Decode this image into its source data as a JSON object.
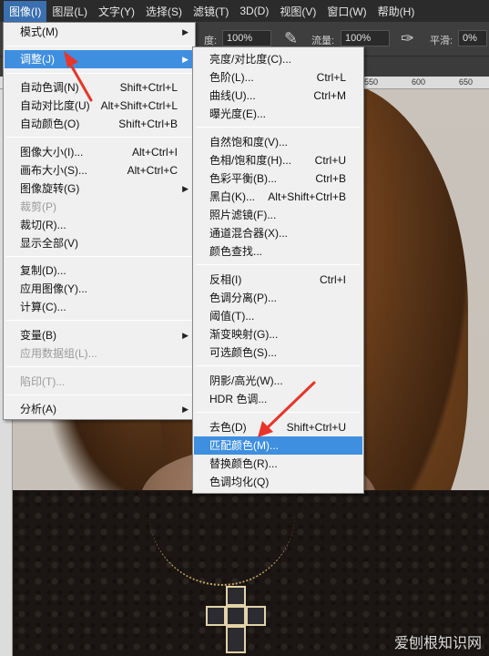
{
  "menubar": {
    "items": [
      {
        "label": "图像(I)",
        "active": true
      },
      {
        "label": "图层(L)"
      },
      {
        "label": "文字(Y)"
      },
      {
        "label": "选择(S)"
      },
      {
        "label": "滤镜(T)"
      },
      {
        "label": "3D(D)"
      },
      {
        "label": "视图(V)"
      },
      {
        "label": "窗口(W)"
      },
      {
        "label": "帮助(H)"
      }
    ]
  },
  "options_bar": {
    "opacity_label": "度:",
    "opacity_value": "100%",
    "flow_label": "流量:",
    "flow_value": "100%",
    "smoothing_label": "平滑:",
    "smoothing_value": "0%"
  },
  "ruler": {
    "top_ticks": [
      "550",
      "600",
      "650"
    ]
  },
  "image_menu": {
    "items": [
      {
        "label": "模式(M)",
        "submenu": true
      },
      {
        "label": "调整(J)",
        "submenu": true,
        "highlighted": true
      },
      {
        "label": "自动色调(N)",
        "shortcut": "Shift+Ctrl+L"
      },
      {
        "label": "自动对比度(U)",
        "shortcut": "Alt+Shift+Ctrl+L"
      },
      {
        "label": "自动颜色(O)",
        "shortcut": "Shift+Ctrl+B"
      },
      {
        "label": "图像大小(I)...",
        "shortcut": "Alt+Ctrl+I"
      },
      {
        "label": "画布大小(S)...",
        "shortcut": "Alt+Ctrl+C"
      },
      {
        "label": "图像旋转(G)",
        "submenu": true
      },
      {
        "label": "裁剪(P)",
        "disabled": true
      },
      {
        "label": "裁切(R)..."
      },
      {
        "label": "显示全部(V)"
      },
      {
        "label": "复制(D)..."
      },
      {
        "label": "应用图像(Y)..."
      },
      {
        "label": "计算(C)..."
      },
      {
        "label": "变量(B)",
        "submenu": true
      },
      {
        "label": "应用数据组(L)...",
        "disabled": true
      },
      {
        "label": "陷印(T)...",
        "disabled": true
      },
      {
        "label": "分析(A)",
        "submenu": true
      }
    ]
  },
  "adjust_menu": {
    "items": [
      {
        "label": "亮度/对比度(C)..."
      },
      {
        "label": "色阶(L)...",
        "shortcut": "Ctrl+L"
      },
      {
        "label": "曲线(U)...",
        "shortcut": "Ctrl+M"
      },
      {
        "label": "曝光度(E)..."
      },
      {
        "label": "自然饱和度(V)..."
      },
      {
        "label": "色相/饱和度(H)...",
        "shortcut": "Ctrl+U"
      },
      {
        "label": "色彩平衡(B)...",
        "shortcut": "Ctrl+B"
      },
      {
        "label": "黑白(K)...",
        "shortcut": "Alt+Shift+Ctrl+B"
      },
      {
        "label": "照片滤镜(F)..."
      },
      {
        "label": "通道混合器(X)..."
      },
      {
        "label": "颜色查找..."
      },
      {
        "label": "反相(I)",
        "shortcut": "Ctrl+I"
      },
      {
        "label": "色调分离(P)..."
      },
      {
        "label": "阈值(T)..."
      },
      {
        "label": "渐变映射(G)..."
      },
      {
        "label": "可选颜色(S)..."
      },
      {
        "label": "阴影/高光(W)..."
      },
      {
        "label": "HDR 色调..."
      },
      {
        "label": "去色(D)",
        "shortcut": "Shift+Ctrl+U"
      },
      {
        "label": "匹配颜色(M)...",
        "highlighted": true
      },
      {
        "label": "替换颜色(R)..."
      },
      {
        "label": "色调均化(Q)"
      }
    ]
  },
  "watermark": "爱刨根知识网",
  "colors": {
    "highlight": "#3f8fe0",
    "annotation_arrow": "#e8342a",
    "menubar_bg": "#2b2b2b"
  }
}
